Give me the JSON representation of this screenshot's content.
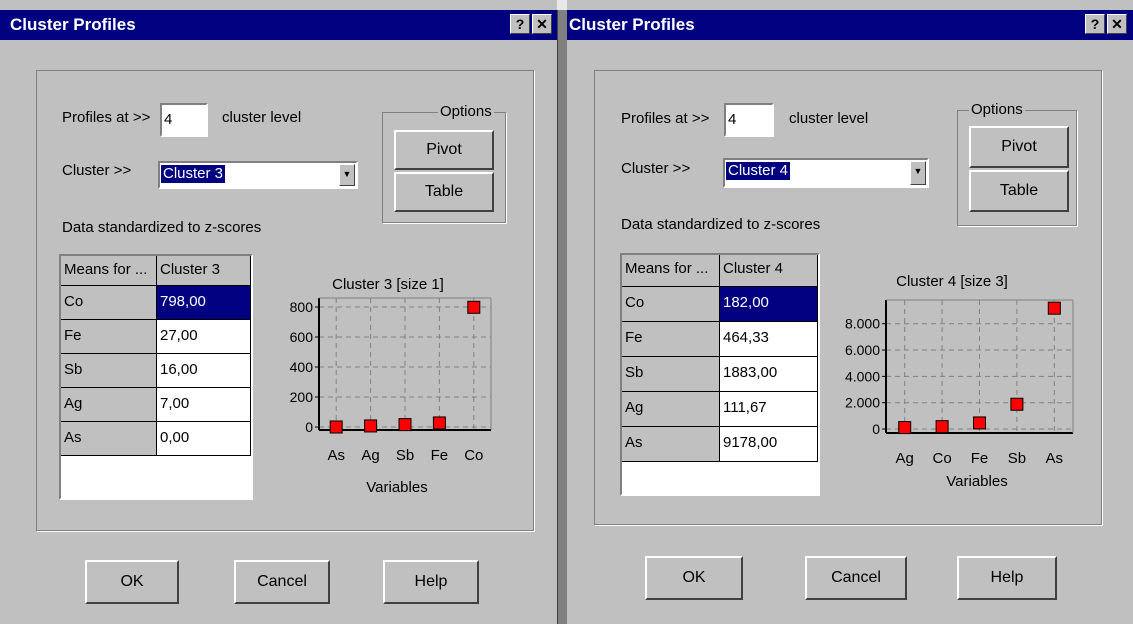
{
  "dialogs": [
    {
      "title": "Cluster Profiles",
      "help_btn": "?",
      "close_btn": "✕",
      "profiles_label": "Profiles at >>",
      "profiles_value": "4",
      "level_label": "cluster level",
      "cluster_label": "Cluster >>",
      "cluster_selected": "Cluster 3",
      "options_label": "Options",
      "pivot_label": "Pivot",
      "table_label": "Table",
      "z_label": "Data standardized to z-scores",
      "table": {
        "headers": [
          "Means for ...",
          "Cluster 3"
        ],
        "rows": [
          [
            "Co",
            "798,00"
          ],
          [
            "Fe",
            "27,00"
          ],
          [
            "Sb",
            "16,00"
          ],
          [
            "Ag",
            "7,00"
          ],
          [
            "As",
            "0,00"
          ]
        ]
      },
      "chart_data": {
        "type": "scatter",
        "title": "Cluster 3 [size 1]",
        "xlabel": "Variables",
        "ylabel": "",
        "categories": [
          "As",
          "Ag",
          "Sb",
          "Fe",
          "Co"
        ],
        "values": [
          0,
          7,
          16,
          27,
          798
        ],
        "yticks": [
          "800",
          "600",
          "400",
          "200",
          "0"
        ],
        "ytick_values": [
          800,
          600,
          400,
          200,
          0
        ],
        "ylim": [
          -20,
          860
        ],
        "marker_color": "#ff0000",
        "grid": true
      },
      "ok_label": "OK",
      "cancel_label": "Cancel",
      "help_label": "Help"
    },
    {
      "title": "Cluster Profiles",
      "help_btn": "?",
      "close_btn": "✕",
      "profiles_label": "Profiles at >>",
      "profiles_value": "4",
      "level_label": "cluster level",
      "cluster_label": "Cluster >>",
      "cluster_selected": "Cluster 4",
      "options_label": "Options",
      "pivot_label": "Pivot",
      "table_label": "Table",
      "z_label": "Data standardized to z-scores",
      "table": {
        "headers": [
          "Means for ...",
          "Cluster 4"
        ],
        "rows": [
          [
            "Co",
            "182,00"
          ],
          [
            "Fe",
            "464,33"
          ],
          [
            "Sb",
            "1883,00"
          ],
          [
            "Ag",
            "111,67"
          ],
          [
            "As",
            "9178,00"
          ]
        ]
      },
      "chart_data": {
        "type": "scatter",
        "title": "Cluster 4 [size 3]",
        "xlabel": "Variables",
        "ylabel": "",
        "categories": [
          "Ag",
          "Co",
          "Fe",
          "Sb",
          "As"
        ],
        "values": [
          111.67,
          182,
          464.33,
          1883,
          9178
        ],
        "yticks": [
          "8.000",
          "6.000",
          "4.000",
          "2.000",
          "0"
        ],
        "ytick_values": [
          8000,
          6000,
          4000,
          2000,
          0
        ],
        "ylim": [
          -300,
          9800
        ],
        "marker_color": "#ff0000",
        "grid": true
      },
      "ok_label": "OK",
      "cancel_label": "Cancel",
      "help_label": "Help"
    }
  ]
}
